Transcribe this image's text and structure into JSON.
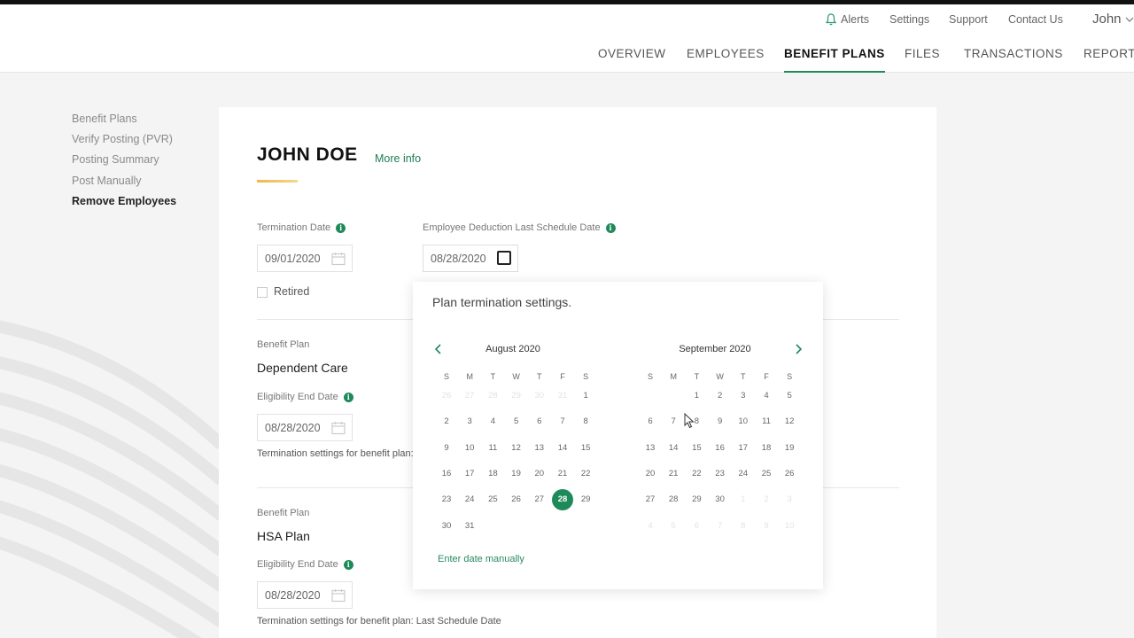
{
  "header": {
    "alerts": "Alerts",
    "settings": "Settings",
    "support": "Support",
    "contact": "Contact Us",
    "user": "John",
    "tabs": [
      "OVERVIEW",
      "EMPLOYEES",
      "BENEFIT PLANS",
      "FILES",
      "TRANSACTIONS",
      "REPORTS"
    ],
    "active_tab": "BENEFIT PLANS"
  },
  "sidebar": {
    "items": [
      {
        "label": "Benefit Plans"
      },
      {
        "label": "Verify Posting (PVR)"
      },
      {
        "label": "Posting Summary"
      },
      {
        "label": "Post Manually"
      },
      {
        "label": "Remove Employees"
      }
    ],
    "active": "Remove Employees"
  },
  "employee": {
    "name": "JOHN DOE",
    "more_info": "More info",
    "termination_date_label": "Termination Date",
    "termination_date": "09/01/2020",
    "deduction_label": "Employee Deduction Last Schedule Date",
    "deduction_date": "08/28/2020",
    "retired_label": "Retired"
  },
  "plans": [
    {
      "section_label": "Benefit Plan",
      "name": "Dependent Care",
      "eligibility_label": "Eligibility End Date",
      "eligibility_date": "08/28/2020",
      "settings_text": "Termination settings for benefit plan:"
    },
    {
      "section_label": "Benefit Plan",
      "name": "HSA Plan",
      "eligibility_label": "Eligibility End Date",
      "eligibility_date": "08/28/2020",
      "settings_text": "Termination settings for benefit plan: Last Schedule Date"
    }
  ],
  "datepicker": {
    "title": "Plan termination settings.",
    "left_month": "August 2020",
    "right_month": "September 2020",
    "weekdays": [
      "S",
      "M",
      "T",
      "W",
      "T",
      "F",
      "S"
    ],
    "left_days": [
      [
        "26",
        "27",
        "28",
        "29",
        "30",
        "31",
        "1"
      ],
      [
        "2",
        "3",
        "4",
        "5",
        "6",
        "7",
        "8"
      ],
      [
        "9",
        "10",
        "11",
        "12",
        "13",
        "14",
        "15"
      ],
      [
        "16",
        "17",
        "18",
        "19",
        "20",
        "21",
        "22"
      ],
      [
        "23",
        "24",
        "25",
        "26",
        "27",
        "28",
        "29"
      ],
      [
        "30",
        "31",
        "",
        "",
        "",
        "",
        ""
      ]
    ],
    "right_days": [
      [
        "",
        "",
        "1",
        "2",
        "3",
        "4",
        "5"
      ],
      [
        "6",
        "7",
        "8",
        "9",
        "10",
        "11",
        "12"
      ],
      [
        "13",
        "14",
        "15",
        "16",
        "17",
        "18",
        "19"
      ],
      [
        "20",
        "21",
        "22",
        "23",
        "24",
        "25",
        "26"
      ],
      [
        "27",
        "28",
        "29",
        "30",
        "1",
        "2",
        "3"
      ],
      [
        "4",
        "5",
        "6",
        "7",
        "8",
        "9",
        "10"
      ]
    ],
    "selected_day": "28",
    "enter_manually": "Enter date manually"
  },
  "colors": {
    "accent": "#1e8a5a",
    "underline": "#f0b94a"
  }
}
